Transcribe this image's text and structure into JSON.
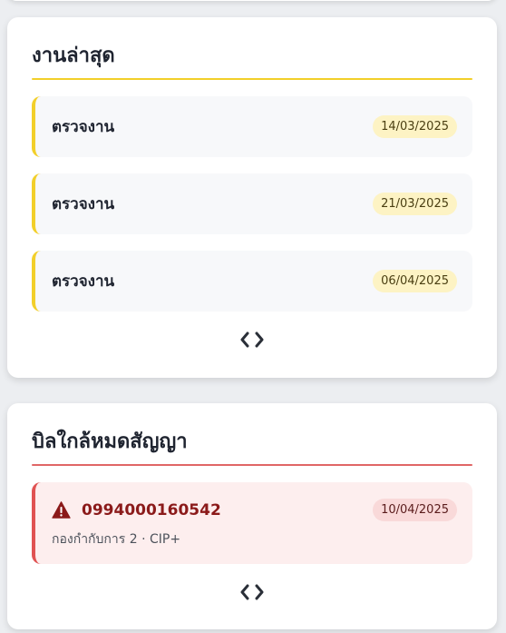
{
  "latest_jobs": {
    "title": "งานล่าสุด",
    "items": [
      {
        "title": "ตรวจงาน",
        "date": "14/03/2025"
      },
      {
        "title": "ตรวจงาน",
        "date": "21/03/2025"
      },
      {
        "title": "ตรวจงาน",
        "date": "06/04/2025"
      }
    ],
    "pager": {
      "prev": "‹",
      "next": "›"
    }
  },
  "expiring_bills": {
    "title": "บิลใกล้หมดสัญญา",
    "items": [
      {
        "number": "0994000160542",
        "subtitle": "กองกำกับการ 2 · CIP+",
        "date": "10/04/2025",
        "icon": "warning-icon"
      }
    ],
    "pager": {
      "prev": "‹",
      "next": "›"
    }
  },
  "colors": {
    "accent_yellow": "#f2cf2a",
    "accent_red": "#e05252",
    "danger_text": "#8b1a1a"
  }
}
